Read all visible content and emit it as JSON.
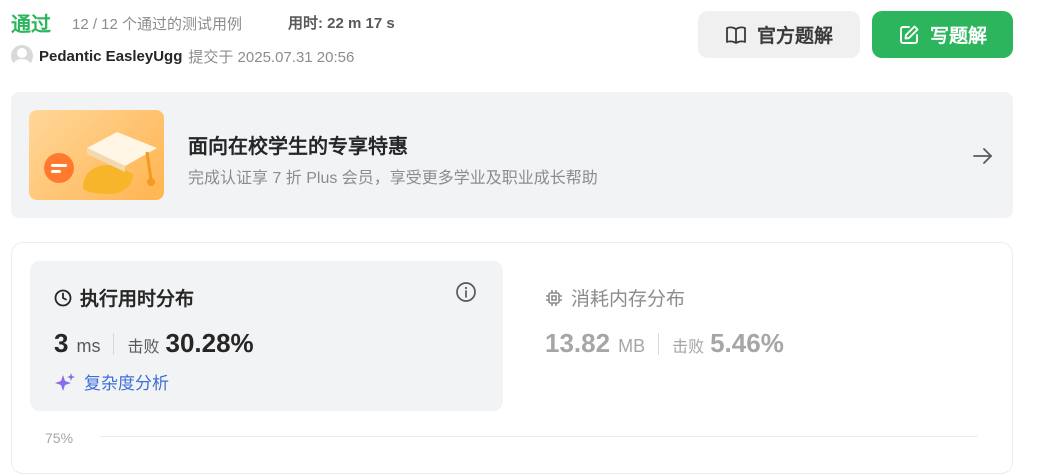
{
  "header": {
    "status": "通过",
    "cases": "12 / 12 个通过的测试用例",
    "time_used": "用时: 22 m 17 s",
    "author": "Pedantic EasleyUgg",
    "submitted": "提交于 2025.07.31 20:56"
  },
  "buttons": {
    "official_solution": "官方题解",
    "write_solution": "写题解"
  },
  "promo": {
    "title": "面向在校学生的专享特惠",
    "subtitle": "完成认证享 7 折 Plus 会员，享受更多学业及职业成长帮助"
  },
  "runtime": {
    "title": "执行用时分布",
    "value": "3",
    "unit": "ms",
    "beat_label": "击败",
    "beat_value": "30.28%",
    "complexity_link": "复杂度分析"
  },
  "memory": {
    "title": "消耗内存分布",
    "value": "13.82",
    "unit": "MB",
    "beat_label": "击败",
    "beat_value": "5.46%"
  },
  "chart": {
    "y_tick": "75%"
  },
  "colors": {
    "accent_green": "#2db55d",
    "link_blue": "#3e6fd8"
  },
  "icons": [
    "book-icon",
    "edit-icon",
    "arrow-right-icon",
    "clock-icon",
    "info-icon",
    "chip-icon",
    "sparkle-icon",
    "avatar"
  ]
}
